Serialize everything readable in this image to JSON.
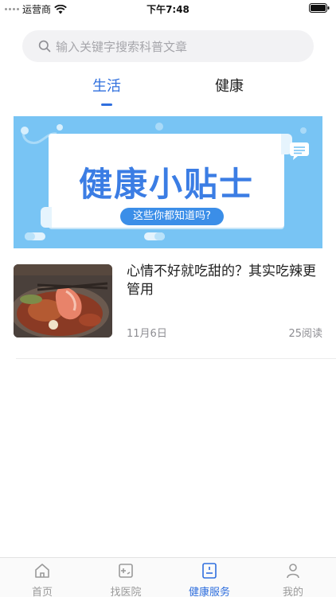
{
  "status_bar": {
    "carrier": "运营商",
    "time": "下午7:48"
  },
  "search": {
    "placeholder": "输入关键字搜索科普文章"
  },
  "tabs": [
    {
      "label": "生活",
      "active": true
    },
    {
      "label": "健康",
      "active": false
    }
  ],
  "banner": {
    "title": "健康小贴士",
    "subtitle": "这些你都知道吗?"
  },
  "articles": [
    {
      "title": "心情不好就吃甜的？其实吃辣更管用",
      "date": "11月6日",
      "reads": "25阅读",
      "thumbnail": "hotpot-image"
    }
  ],
  "tabbar": [
    {
      "label": "首页",
      "icon": "home-icon",
      "active": false
    },
    {
      "label": "找医院",
      "icon": "hospital-icon",
      "active": false
    },
    {
      "label": "健康服务",
      "icon": "health-service-icon",
      "active": true
    },
    {
      "label": "我的",
      "icon": "profile-icon",
      "active": false
    }
  ],
  "colors": {
    "accent": "#2f6fde",
    "banner_bg": "#78c4f4",
    "search_bg": "#f2f2f4",
    "muted_text": "#8e8e93"
  }
}
